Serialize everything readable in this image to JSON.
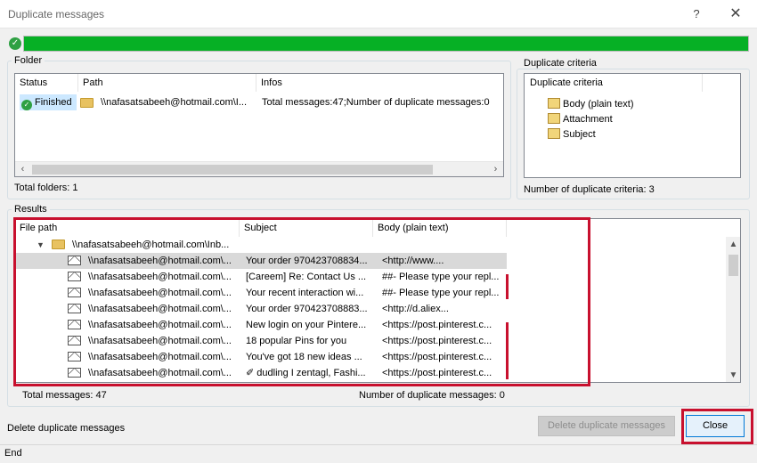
{
  "window": {
    "title": "Duplicate messages",
    "help": "?",
    "close": "✕"
  },
  "progress": {
    "fraction": 1.0,
    "color": "#06b025"
  },
  "folder": {
    "group_label": "Folder",
    "columns": [
      "Status",
      "Path",
      "Infos"
    ],
    "row": {
      "status": "Finished",
      "path": "\\\\nafasatsabeeh@hotmail.com\\I...",
      "infos": "Total messages:47;Number of duplicate messages:0"
    },
    "total_label": "Total folders: 1"
  },
  "criteria": {
    "group_label": "Duplicate criteria",
    "column": "Duplicate criteria",
    "items": [
      "Body (plain text)",
      "Attachment",
      "Subject"
    ],
    "count_label": "Number of duplicate criteria: 3"
  },
  "results": {
    "group_label": "Results",
    "columns": [
      "File path",
      "Subject",
      "Body (plain text)"
    ],
    "root": "\\\\nafasatsabeeh@hotmail.com\\Inb...",
    "rows": [
      {
        "path": "\\\\nafasatsabeeh@hotmail.com\\...",
        "subject": "Your order  970423708834...",
        "body": "<http://www...."
      },
      {
        "path": "\\\\nafasatsabeeh@hotmail.com\\...",
        "subject": "[Careem] Re: Contact Us ...",
        "body": "##- Please type your repl..."
      },
      {
        "path": "\\\\nafasatsabeeh@hotmail.com\\...",
        "subject": "Your recent interaction wi...",
        "body": "##- Please type your repl..."
      },
      {
        "path": "\\\\nafasatsabeeh@hotmail.com\\...",
        "subject": "Your order  970423708883...",
        "body": "<http://d.aliex..."
      },
      {
        "path": "\\\\nafasatsabeeh@hotmail.com\\...",
        "subject": "New login on your Pintere...",
        "body": "<https://post.pinterest.c..."
      },
      {
        "path": "\\\\nafasatsabeeh@hotmail.com\\...",
        "subject": "18 popular Pins for you",
        "body": "<https://post.pinterest.c..."
      },
      {
        "path": "\\\\nafasatsabeeh@hotmail.com\\...",
        "subject": "You've got 18 new ideas ...",
        "body": "<https://post.pinterest.c..."
      },
      {
        "path": "\\\\nafasatsabeeh@hotmail.com\\...",
        "subject": "✐ dudling I zentagl, Fashi...",
        "body": "<https://post.pinterest.c..."
      }
    ],
    "total_messages": "Total messages: 47",
    "duplicate_messages": "Number of duplicate messages: 0"
  },
  "footer": {
    "delete_label": "Delete duplicate messages",
    "delete_button": "Delete duplicate messages",
    "close_button": "Close"
  },
  "statusbar": {
    "text": "End"
  },
  "colors": {
    "accent_red": "#c8102e",
    "ok_green": "#2ea043",
    "progress_green": "#06b025"
  }
}
